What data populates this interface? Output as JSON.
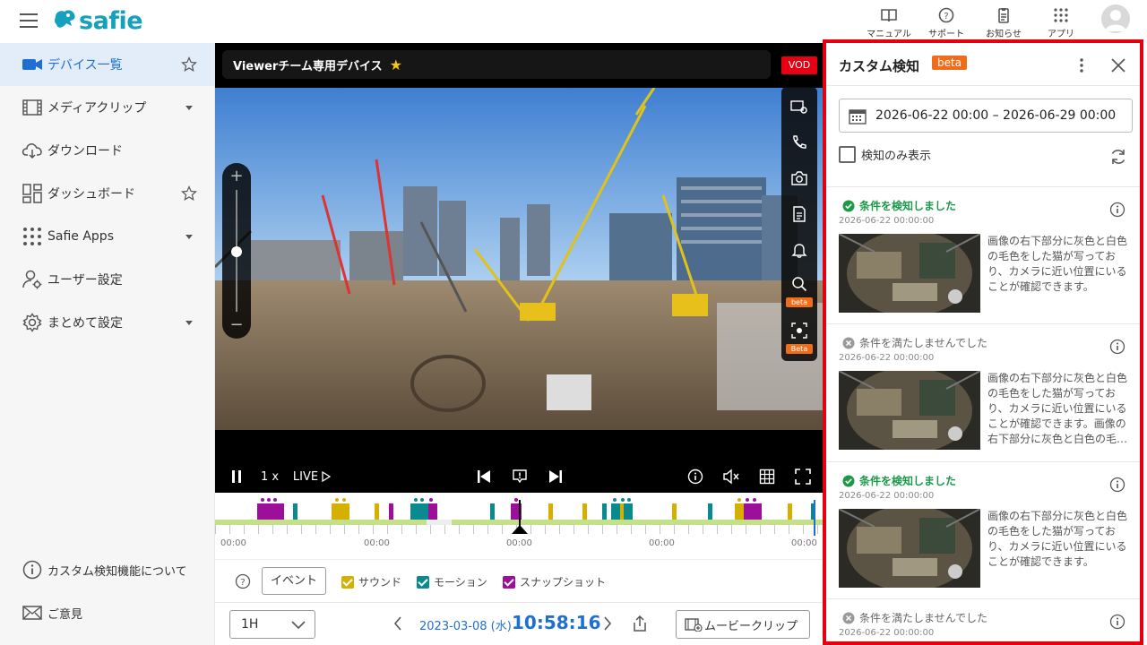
{
  "app": {
    "logo_text": "safie",
    "brand_color": "#14a0be"
  },
  "header": {
    "buttons": [
      {
        "label": "マニュアル",
        "icon": "book-icon"
      },
      {
        "label": "サポート",
        "icon": "help-circle-icon"
      },
      {
        "label": "お知らせ",
        "icon": "clipboard-icon"
      },
      {
        "label": "アプリ",
        "icon": "grid-dots-icon"
      }
    ]
  },
  "sidebar": {
    "items": [
      {
        "label": "デバイス一覧",
        "icon": "camera-icon",
        "active": true
      },
      {
        "label": "メディアクリップ",
        "icon": "film-icon"
      },
      {
        "label": "ダウンロード",
        "icon": "cloud-download-icon"
      },
      {
        "label": "ダッシュボード",
        "icon": "dashboard-icon"
      },
      {
        "label": "Safie Apps",
        "icon": "apps-dots-icon"
      },
      {
        "label": "ユーザー設定",
        "icon": "user-gear-icon"
      },
      {
        "label": "まとめて設定",
        "icon": "gear-icon"
      }
    ],
    "footer": [
      {
        "label": "カスタム検知機能について",
        "icon": "info-circle-icon"
      },
      {
        "label": "ご意見",
        "icon": "mail-icon"
      }
    ]
  },
  "viewer": {
    "device_title": "Viewerチーム専用デバイス",
    "mode_badge": "VOD",
    "tool_beta_1": "beta",
    "tool_beta_2": "Beta",
    "speed": "1 x",
    "live_label": "LIVE"
  },
  "timeline": {
    "labels": [
      "00:00",
      "00:00",
      "00:00",
      "00:00",
      "00:00"
    ]
  },
  "legend": {
    "event_button": "イベント",
    "items": [
      {
        "label": "サウンド",
        "color": "#d6b000"
      },
      {
        "label": "モーション",
        "color": "#0a8a8f"
      },
      {
        "label": "スナップショット",
        "color": "#9b0f9b"
      }
    ]
  },
  "bottombar": {
    "range": "1H",
    "date": "2023-03-08 (水)",
    "time": "10:58:16",
    "movie_clip": "ムービークリップ"
  },
  "panel": {
    "title": "カスタム検知",
    "beta": "beta",
    "date_range": "2026-06-22 00:00 – 2026-06-29 00:00",
    "only_detected_label": "検知のみ表示",
    "results": [
      {
        "status": "条件を検知しました",
        "detected": true,
        "timestamp": "2026-06-22 00:00:00",
        "description": "画像の右下部分に灰色と白色の毛色をした猫が写っており、カメラに近い位置にいることが確認できます。"
      },
      {
        "status": "条件を満たしませんでした",
        "detected": false,
        "timestamp": "2026-06-22 00:00:00",
        "description": "画像の右下部分に灰色と白色の毛色をした猫が写っており、カメラに近い位置にいることが確認できます。画像の右下部分に灰色と白色の毛…"
      },
      {
        "status": "条件を検知しました",
        "detected": true,
        "timestamp": "2026-06-22 00:00:00",
        "description": "画像の右下部分に灰色と白色の毛色をした猫が写っており、カメラに近い位置にいることが確認できます。"
      },
      {
        "status": "条件を満たしませんでした",
        "detected": false,
        "timestamp": "2026-06-22 00:00:00",
        "description": ""
      }
    ]
  }
}
